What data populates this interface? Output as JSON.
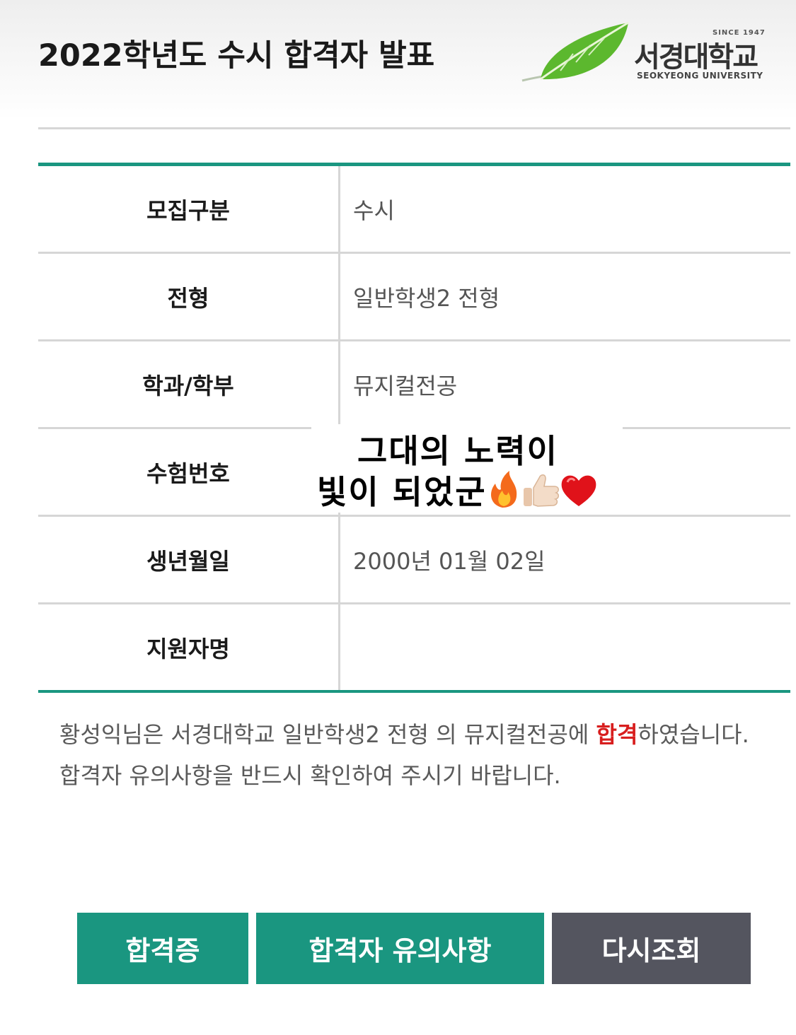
{
  "header": {
    "title": "2022학년도 수시 합격자 발표",
    "logo": {
      "since": "SINCE 1947",
      "name": "서경대학교",
      "english": "SEOKYEONG UNIVERSITY",
      "leaf_color": "#5cb82e"
    }
  },
  "table": {
    "accent_color": "#1a9680",
    "rows": [
      {
        "label": "모집구분",
        "value": "수시"
      },
      {
        "label": "전형",
        "value": "일반학생2 전형"
      },
      {
        "label": "학과/학부",
        "value": "뮤지컬전공"
      },
      {
        "label": "수험번호",
        "value": ""
      },
      {
        "label": "생년월일",
        "value": "2000년 01월 02일"
      },
      {
        "label": "지원자명",
        "value": ""
      }
    ]
  },
  "overlay": {
    "line1": "그대의 노력이",
    "line2": "빛이 되었군",
    "emojis": [
      "fire-emoji",
      "thumbs-up-emoji",
      "heart-emoji"
    ]
  },
  "message": {
    "name": "황성익",
    "part1": "님은 서경대학교 일반학생2 전형 의 뮤지컬전공에 ",
    "pass_word": "합격",
    "part2": "하였습니다.",
    "line2": "합격자 유의사항을 반드시 확인하여 주시기 바랍니다."
  },
  "buttons": {
    "certificate": "합격증",
    "notice": "합격자 유의사항",
    "retry": "다시조회",
    "primary_color": "#1a9680",
    "secondary_color": "#54555f"
  }
}
